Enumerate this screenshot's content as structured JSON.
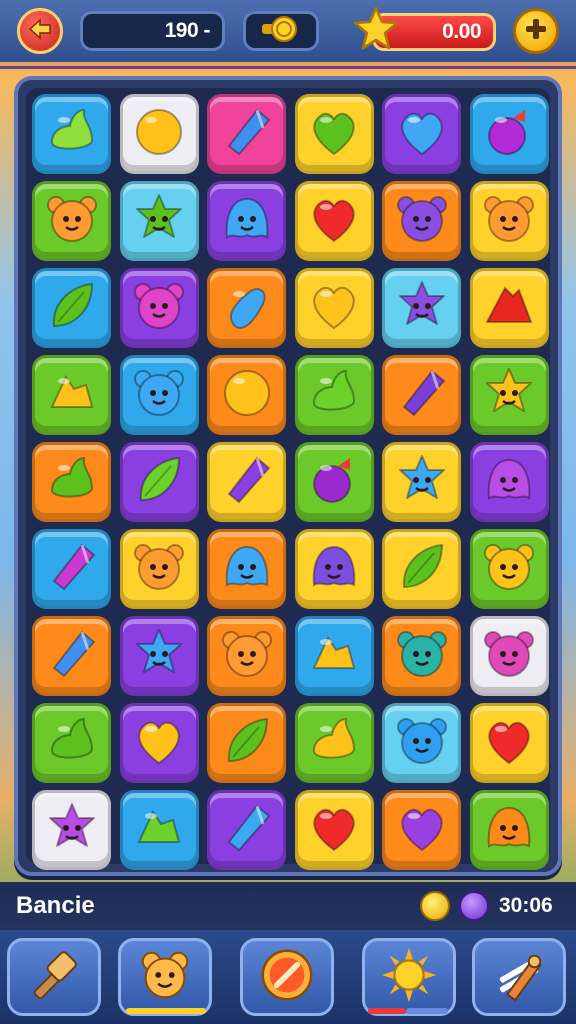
{
  "header": {
    "back_icon": "back-arrow-icon",
    "score_value": "190 -",
    "coin_icon": "coin-icon",
    "star_icon": "star-icon",
    "star_value": "0.00",
    "add_icon": "plus-icon"
  },
  "colors": {
    "blue": "#2fa8ec",
    "green": "#6cc92a",
    "yellow": "#ffd12a",
    "purple": "#8a3fe0",
    "orange": "#ff8a1c",
    "pink": "#f0449a",
    "white": "#ededf3",
    "lightblue": "#66d0f0"
  },
  "board": {
    "rows": [
      [
        {
          "bg": "blue",
          "icon": "leaf-drop",
          "c": "#8fe03a"
        },
        {
          "bg": "white",
          "icon": "circle",
          "c": "#ffc21a"
        },
        {
          "bg": "pink",
          "icon": "crystal",
          "c": "#3f8ef0"
        },
        {
          "bg": "yellow",
          "icon": "heart",
          "c": "#5cc11c"
        },
        {
          "bg": "purple",
          "icon": "heart",
          "c": "#3ea8f4"
        },
        {
          "bg": "blue",
          "icon": "berry",
          "c": "#b02ad6"
        }
      ],
      [
        {
          "bg": "green",
          "icon": "bear",
          "c": "#ff9b32"
        },
        {
          "bg": "lightblue",
          "icon": "star",
          "c": "#5cc11c"
        },
        {
          "bg": "purple",
          "icon": "blob",
          "c": "#3ea8f4"
        },
        {
          "bg": "yellow",
          "icon": "heart",
          "c": "#ef2a2a"
        },
        {
          "bg": "orange",
          "icon": "bear",
          "c": "#8a4fe0"
        },
        {
          "bg": "yellow",
          "icon": "bear",
          "c": "#ff9b32"
        }
      ],
      [
        {
          "bg": "blue",
          "icon": "leaf",
          "c": "#5cc11c"
        },
        {
          "bg": "purple",
          "icon": "bear",
          "c": "#e044c8"
        },
        {
          "bg": "orange",
          "icon": "bean",
          "c": "#3ea8f4"
        },
        {
          "bg": "yellow",
          "icon": "heart",
          "c": "#ffc21a"
        },
        {
          "bg": "lightblue",
          "icon": "star",
          "c": "#8a4fe0"
        },
        {
          "bg": "yellow",
          "icon": "mountain",
          "c": "#e8271f"
        }
      ],
      [
        {
          "bg": "green",
          "icon": "bolt",
          "c": "#ffc21a"
        },
        {
          "bg": "blue",
          "icon": "bear",
          "c": "#3ea8f4"
        },
        {
          "bg": "orange",
          "icon": "circle",
          "c": "#ffc21a"
        },
        {
          "bg": "green",
          "icon": "leaf-drop",
          "c": "#6cd12a"
        },
        {
          "bg": "orange",
          "icon": "crystal",
          "c": "#7a3fd8"
        },
        {
          "bg": "green",
          "icon": "star",
          "c": "#ffc21a"
        }
      ],
      [
        {
          "bg": "orange",
          "icon": "leaf-drop",
          "c": "#5cc11c"
        },
        {
          "bg": "purple",
          "icon": "leaf",
          "c": "#6cd12a"
        },
        {
          "bg": "yellow",
          "icon": "crystal",
          "c": "#8a3fe0"
        },
        {
          "bg": "green",
          "icon": "berry",
          "c": "#9a2ad0"
        },
        {
          "bg": "yellow",
          "icon": "star",
          "c": "#3ea8f4"
        },
        {
          "bg": "purple",
          "icon": "blob",
          "c": "#b84ee6"
        }
      ],
      [
        {
          "bg": "blue",
          "icon": "crystal",
          "c": "#c83ad0"
        },
        {
          "bg": "yellow",
          "icon": "bear",
          "c": "#ff9b32"
        },
        {
          "bg": "orange",
          "icon": "blob",
          "c": "#3ea8f4"
        },
        {
          "bg": "yellow",
          "icon": "blob",
          "c": "#7a4fe0"
        },
        {
          "bg": "yellow",
          "icon": "leaf",
          "c": "#5cc11c"
        },
        {
          "bg": "green",
          "icon": "bear",
          "c": "#ffc21a"
        }
      ],
      [
        {
          "bg": "orange",
          "icon": "crystal",
          "c": "#3f8ef0"
        },
        {
          "bg": "purple",
          "icon": "star",
          "c": "#3ea8f4"
        },
        {
          "bg": "orange",
          "icon": "bear",
          "c": "#ff9b32"
        },
        {
          "bg": "blue",
          "icon": "bolt",
          "c": "#ffc21a"
        },
        {
          "bg": "orange",
          "icon": "bear",
          "c": "#2ab4a8"
        },
        {
          "bg": "white",
          "icon": "bear",
          "c": "#e04ab8"
        }
      ],
      [
        {
          "bg": "green",
          "icon": "leaf-drop",
          "c": "#5cc11c"
        },
        {
          "bg": "purple",
          "icon": "heart",
          "c": "#ffc21a"
        },
        {
          "bg": "orange",
          "icon": "leaf",
          "c": "#5cc11c"
        },
        {
          "bg": "green",
          "icon": "leaf-drop",
          "c": "#ffc21a"
        },
        {
          "bg": "lightblue",
          "icon": "bear",
          "c": "#2fa0f0"
        },
        {
          "bg": "yellow",
          "icon": "heart",
          "c": "#ef2a2a"
        }
      ],
      [
        {
          "bg": "white",
          "icon": "star",
          "c": "#b84ee6"
        },
        {
          "bg": "blue",
          "icon": "bolt",
          "c": "#6cd12a"
        },
        {
          "bg": "purple",
          "icon": "crystal",
          "c": "#3ea8f4"
        },
        {
          "bg": "yellow",
          "icon": "heart",
          "c": "#ef2a2a"
        },
        {
          "bg": "orange",
          "icon": "heart",
          "c": "#9a3fe0"
        },
        {
          "bg": "green",
          "icon": "blob",
          "c": "#ff8a1c"
        }
      ]
    ]
  },
  "status": {
    "level_name": "Bancie",
    "coin_icon": "coin-icon",
    "gem_icon": "gem-icon",
    "time": "30:06"
  },
  "boosters": [
    {
      "name": "hammer-booster",
      "icon": "hammer-icon"
    },
    {
      "name": "bear-booster",
      "icon": "bear-face-icon"
    },
    {
      "name": "shuffle-booster",
      "icon": "ban-icon"
    },
    {
      "name": "sun-booster",
      "icon": "sun-icon"
    },
    {
      "name": "rocket-booster",
      "icon": "rocket-icon"
    }
  ]
}
